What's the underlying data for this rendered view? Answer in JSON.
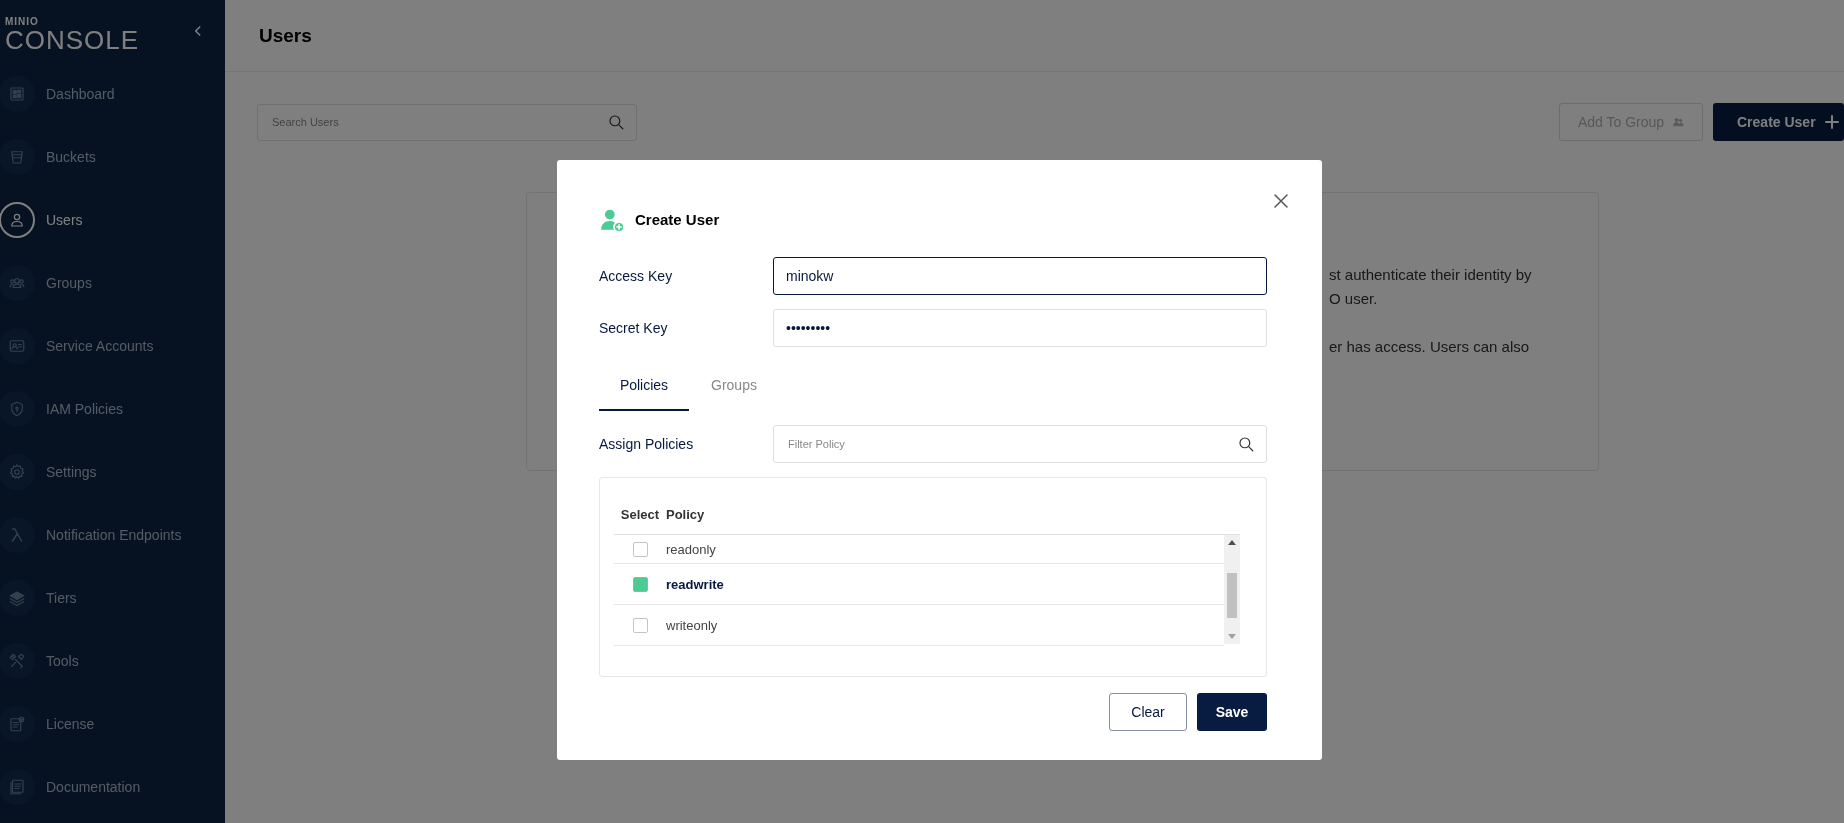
{
  "sidebar": {
    "logo": {
      "small": "MINIO",
      "large": "CONSOLE"
    },
    "items": [
      {
        "label": "Dashboard",
        "selected": false
      },
      {
        "label": "Buckets",
        "selected": false
      },
      {
        "label": "Users",
        "selected": true
      },
      {
        "label": "Groups",
        "selected": false
      },
      {
        "label": "Service Accounts",
        "selected": false
      },
      {
        "label": "IAM Policies",
        "selected": false
      },
      {
        "label": "Settings",
        "selected": false
      },
      {
        "label": "Notification Endpoints",
        "selected": false
      },
      {
        "label": "Tiers",
        "selected": false
      },
      {
        "label": "Tools",
        "selected": false
      },
      {
        "label": "License",
        "selected": false
      },
      {
        "label": "Documentation",
        "selected": false
      }
    ]
  },
  "page": {
    "title": "Users",
    "search": {
      "placeholder": "Search Users"
    },
    "buttons": [
      {
        "label": "Add To Group",
        "disabled": true
      },
      {
        "label": "Create User",
        "disabled": false
      }
    ],
    "card_lines": [
      "st authenticate their identity by",
      "O user.",
      "er has access. Users can also"
    ]
  },
  "dialog": {
    "title": "Create User",
    "fields": [
      {
        "label": "Access Key",
        "value": "minokw",
        "focused": true
      },
      {
        "label": "Secret Key",
        "value": "•••••••••",
        "focused": false
      }
    ],
    "tabs": [
      {
        "label": "Policies",
        "selected": true
      },
      {
        "label": "Groups",
        "selected": false
      }
    ],
    "filter": {
      "label": "Assign Policies",
      "placeholder": "Filter Policy"
    },
    "table": {
      "columns": [
        "Select",
        "Policy"
      ],
      "rows": [
        {
          "policy": "readonly",
          "checked": false
        },
        {
          "policy": "readwrite",
          "checked": true
        },
        {
          "policy": "writeonly",
          "checked": false
        }
      ]
    },
    "buttons": [
      {
        "label": "Clear",
        "kind": "outline"
      },
      {
        "label": "Save",
        "kind": "primary"
      }
    ]
  }
}
